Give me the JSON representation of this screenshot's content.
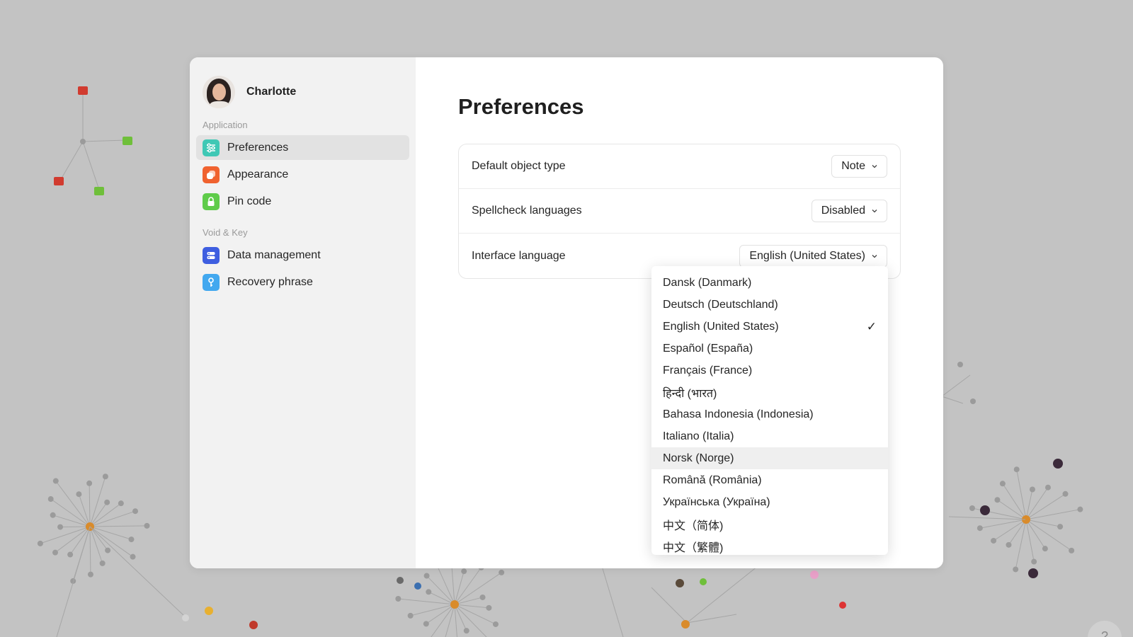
{
  "profile": {
    "name": "Charlotte"
  },
  "sidebar": {
    "sections": [
      {
        "label": "Application",
        "items": [
          {
            "label": "Preferences",
            "icon": "sliders-icon",
            "color": "#3fc8b5",
            "active": true
          },
          {
            "label": "Appearance",
            "icon": "appearance-icon",
            "color": "#f0622f",
            "active": false
          },
          {
            "label": "Pin code",
            "icon": "lock-icon",
            "color": "#5fcc4a",
            "active": false
          }
        ]
      },
      {
        "label": "Void & Key",
        "items": [
          {
            "label": "Data management",
            "icon": "database-icon",
            "color": "#3e5ee0",
            "active": false
          },
          {
            "label": "Recovery phrase",
            "icon": "key-icon",
            "color": "#42a8ef",
            "active": false
          }
        ]
      }
    ]
  },
  "main": {
    "title": "Preferences",
    "settings": [
      {
        "label": "Default object type",
        "value": "Note"
      },
      {
        "label": "Spellcheck languages",
        "value": "Disabled"
      },
      {
        "label": "Interface language",
        "value": "English (United States)"
      }
    ]
  },
  "dropdown": {
    "selected": "English (United States)",
    "hovered": "Norsk (Norge)",
    "check_glyph": "✓",
    "options": [
      "Dansk (Danmark)",
      "Deutsch (Deutschland)",
      "English (United States)",
      "Español (España)",
      "Français (France)",
      "हिन्दी (भारत)",
      "Bahasa Indonesia (Indonesia)",
      "Italiano (Italia)",
      "Norsk (Norge)",
      "Română (România)",
      "Українська (Україна)",
      "中文（简体)",
      "中文（繁體)"
    ]
  },
  "help": {
    "label": "?"
  }
}
